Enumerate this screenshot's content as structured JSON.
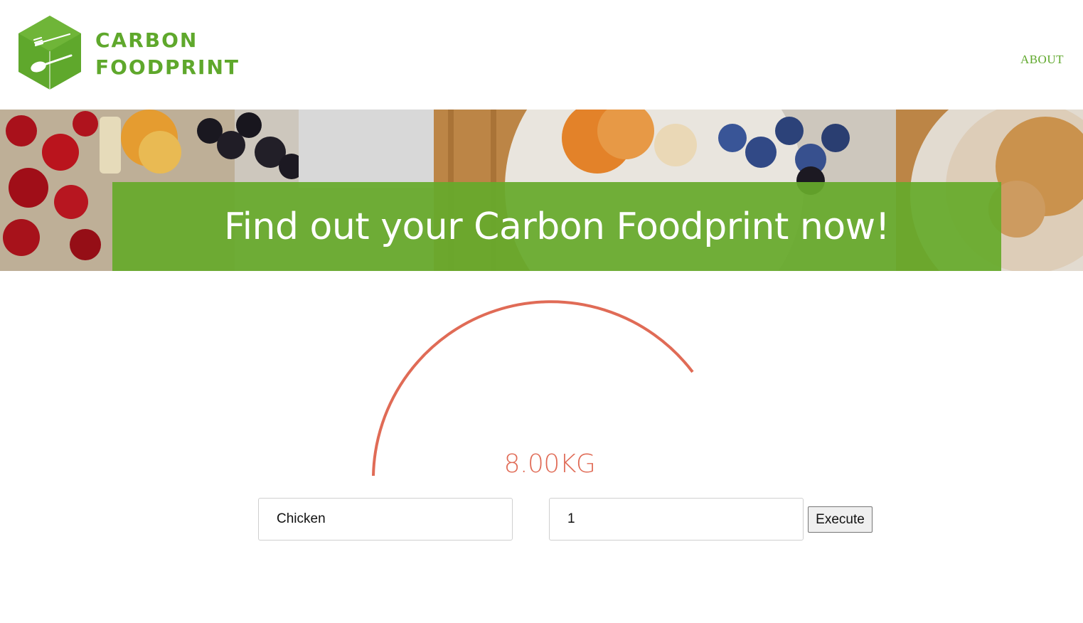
{
  "brand": {
    "line1": "CARBON",
    "line2": "FOODPRINT",
    "color": "#5fa82c"
  },
  "nav": {
    "about_label": "ABOUT"
  },
  "hero": {
    "title": "Find out your Carbon Foodprint now!",
    "band_color": "#66aa2b"
  },
  "gauge": {
    "value_label": "8.00KG",
    "color": "#e06b56"
  },
  "form": {
    "food_value": "Chicken",
    "quantity_value": "1",
    "execute_label": "Execute"
  }
}
